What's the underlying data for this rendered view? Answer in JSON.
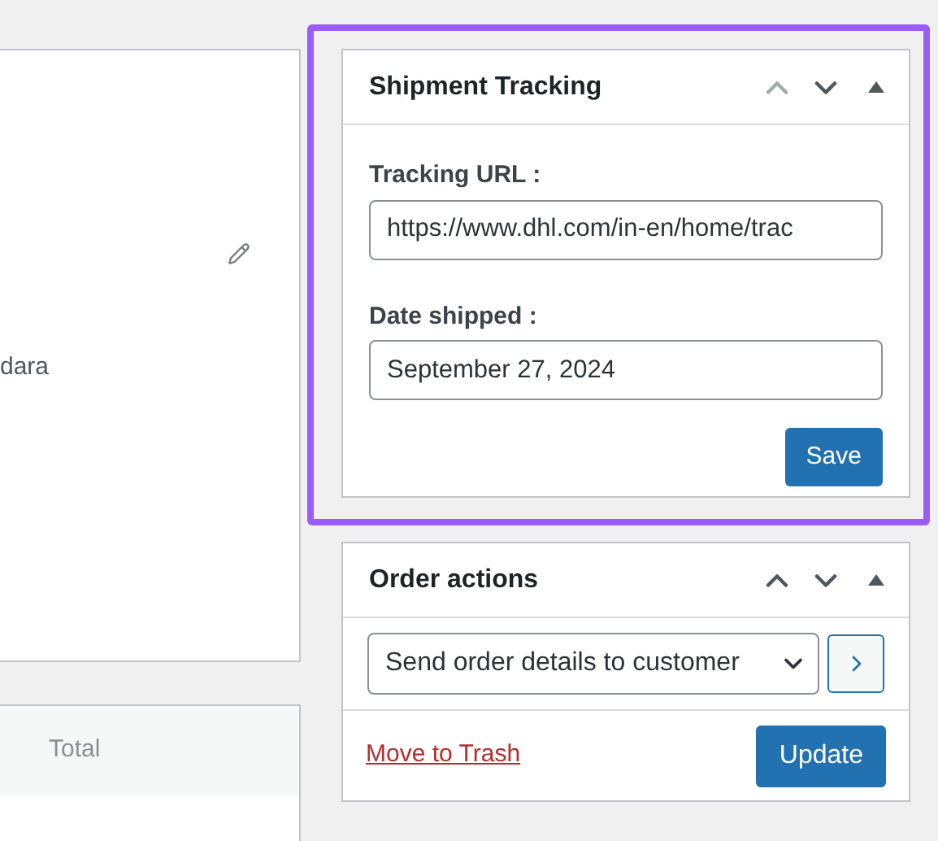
{
  "customer_card": {
    "text": "dara"
  },
  "items_card": {
    "columns": [
      "Total"
    ]
  },
  "shipment_tracking": {
    "title": "Shipment Tracking",
    "highlighted": true,
    "move_up_disabled": true,
    "move_down_disabled": false,
    "fields": [
      {
        "label": "Tracking URL :",
        "value": "https://www.dhl.com/in-en/home/trac"
      },
      {
        "label": "Date shipped :",
        "value": "September 27, 2024"
      }
    ],
    "save_button": "Save"
  },
  "order_actions": {
    "title": "Order actions",
    "move_up_disabled": false,
    "move_down_disabled": false,
    "action": "Send order details to customer",
    "trash_link": "Move to Trash",
    "update_button": "Update"
  }
}
